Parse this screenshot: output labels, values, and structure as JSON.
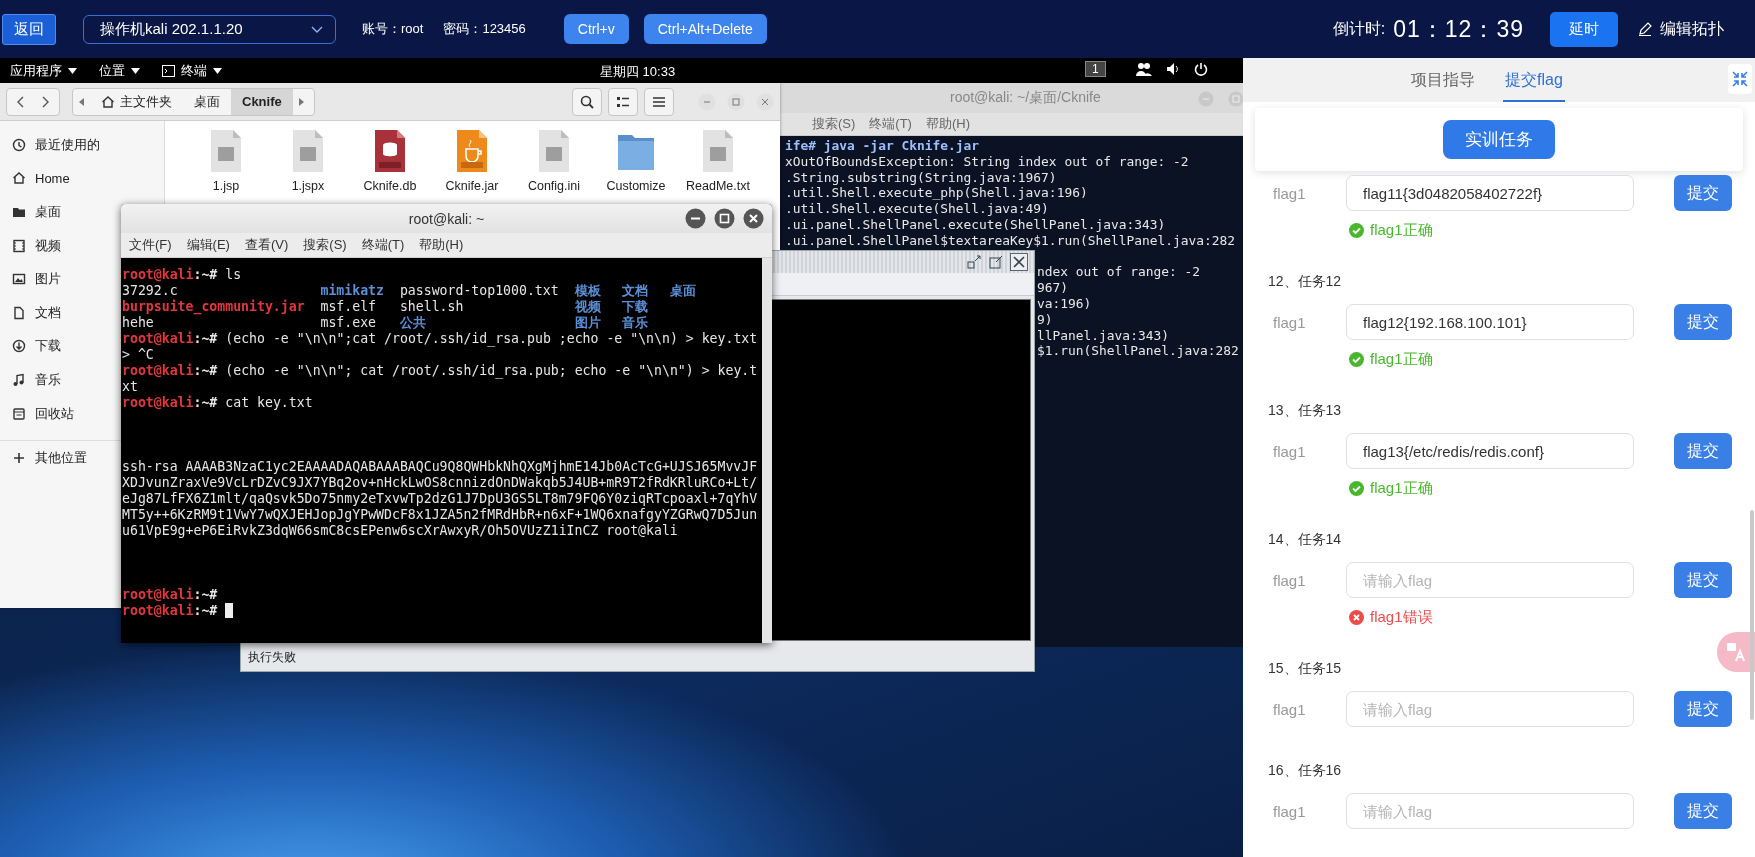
{
  "top_bar": {
    "back_button": "返回",
    "machine_select": "操作机kali 202.1.1.20",
    "account": "账号：root",
    "password": "密码：123456",
    "buttons": [
      "Ctrl+v",
      "Ctrl+Alt+Delete"
    ],
    "countdown_label": "倒计时:",
    "countdown": "01：12：39",
    "extend_button": "延时",
    "edit_topology": "编辑拓扑"
  },
  "desktop": {
    "panel": {
      "menus": [
        "应用程序",
        "位置",
        "终端"
      ],
      "clock": "星期四 10:33",
      "workspace": "1"
    },
    "file_manager": {
      "breadcrumb": [
        {
          "label": "主文件夹",
          "selected": false
        },
        {
          "label": "桌面",
          "selected": false
        },
        {
          "label": "Cknife",
          "selected": true
        }
      ],
      "sidebar": [
        {
          "label": "最近使用的",
          "kind": "recent"
        },
        {
          "label": "Home",
          "kind": "home"
        },
        {
          "label": "桌面",
          "kind": "desktop"
        },
        {
          "label": "视频",
          "kind": "video"
        },
        {
          "label": "图片",
          "kind": "pictures"
        },
        {
          "label": "文档",
          "kind": "documents"
        },
        {
          "label": "下载",
          "kind": "downloads"
        },
        {
          "label": "音乐",
          "kind": "music"
        },
        {
          "label": "回收站",
          "kind": "trash"
        },
        {
          "label": "其他位置",
          "kind": "other"
        }
      ],
      "files": [
        {
          "name": "1.jsp",
          "kind": "text"
        },
        {
          "name": "1.jspx",
          "kind": "text"
        },
        {
          "name": "Cknife.db",
          "kind": "sql"
        },
        {
          "name": "Cknife.jar",
          "kind": "jar"
        },
        {
          "name": "Config.ini",
          "kind": "text"
        },
        {
          "name": "Customize",
          "kind": "folder"
        },
        {
          "name": "ReadMe.txt",
          "kind": "text"
        }
      ]
    },
    "background_terminal": {
      "title": "root@kali: ~/桌面/Cknife",
      "menus": [
        "搜索(S)",
        "终端(T)",
        "帮助(H)"
      ],
      "lines": [
        "ife# java -jar Cknife.jar",
        "xOutOfBoundsException: String index out of range: -2",
        ".String.substring(String.java:1967)",
        ".util.Shell.execute_php(Shell.java:196)",
        ".util.Shell.execute(Shell.java:49)",
        ".ui.panel.ShellPanel.execute(ShellPanel.java:343)",
        ".ui.panel.ShellPanel$textareaKey$1.run(ShellPanel.java:282"
      ],
      "lines_partial": [
        "ndex out of range: -2",
        "967)",
        "va:196)",
        "9)",
        "llPanel.java:343)",
        "$1.run(ShellPanel.java:282"
      ]
    },
    "cknife_window": {
      "status": "执行失败"
    },
    "terminal": {
      "title": "root@kali: ~",
      "menus": [
        "文件(F)",
        "编辑(E)",
        "查看(V)",
        "搜索(S)",
        "终端(T)",
        "帮助(H)"
      ],
      "lines": [
        {
          "kind": "prompt",
          "user": "root@kali",
          "path": ":~#",
          "command": "ls"
        },
        {
          "kind": "ls",
          "cells": [
            {
              "text": "37292.c",
              "kind": "file"
            },
            {
              "text": "mimikatz",
              "kind": "dir"
            },
            {
              "text": "password-top1000.txt",
              "kind": "file"
            },
            {
              "text": "模板",
              "kind": "dir"
            },
            {
              "text": "文档",
              "kind": "dir"
            },
            {
              "text": "桌面",
              "kind": "dir"
            }
          ]
        },
        {
          "kind": "ls",
          "cells": [
            {
              "text": "burpsuite_community.jar",
              "kind": "archive"
            },
            {
              "text": "msf.elf",
              "kind": "file"
            },
            {
              "text": "shell.sh",
              "kind": "file"
            },
            {
              "text": "视频",
              "kind": "dir"
            },
            {
              "text": "下载",
              "kind": "dir"
            }
          ]
        },
        {
          "kind": "ls",
          "cells": [
            {
              "text": "hehe",
              "kind": "file"
            },
            {
              "text": "msf.exe",
              "kind": "file"
            },
            {
              "text": "公共",
              "kind": "dir"
            },
            {
              "text": "图片",
              "kind": "dir"
            },
            {
              "text": "音乐",
              "kind": "dir"
            }
          ]
        },
        {
          "kind": "prompt",
          "user": "root@kali",
          "path": ":~#",
          "command": "(echo -e \"\\n\\n\";cat /root/.ssh/id_rsa.pub ;echo -e \"\\n\\n) > key.txt"
        },
        {
          "kind": "output",
          "text": "> ^C"
        },
        {
          "kind": "prompt",
          "user": "root@kali",
          "path": ":~#",
          "command": "(echo -e \"\\n\\n\"; cat /root/.ssh/id_rsa.pub; echo -e \"\\n\\n\") > key.txt"
        },
        {
          "kind": "prompt",
          "user": "root@kali",
          "path": ":~#",
          "command": "cat key.txt"
        },
        {
          "kind": "blank"
        },
        {
          "kind": "blank"
        },
        {
          "kind": "blank"
        },
        {
          "kind": "output",
          "text": "ssh-rsa AAAAB3NzaC1yc2EAAAADAQABAAABAQCu9Q8QWHbkNhQXgMjhmE14Jb0AcTcG+UJSJ65MvvJFXDJvunZraxVe9VcLrDZvC9JX7YBq2ov+nHckLwOS8cnnizdOnDWakqb5J4UB+mR9T2fRdKRluRCo+Lt/eJg87LfFX6Z1mlt/qaQsvk5Do75nmy2eTxvwTp2dzG1J7DpU3GS5LT8m79FQ6Y0ziqRTcpoaxl+7qYhVMT5y++6KzRM9t1VwY7wQXJEHJopJgYPwWDcF8x1JZA5n2fMRdHbR+n6xF+1WQ6xnafgyYZGRwQ7D5Junu61VpE9g+eP6EiRvkZ3dqW66smC8csEPenw6scXrAwxyR/Oh5OVUzZ1iInCZ root@kali"
        },
        {
          "kind": "blank"
        },
        {
          "kind": "blank"
        },
        {
          "kind": "blank"
        },
        {
          "kind": "prompt",
          "user": "root@kali",
          "path": ":~#"
        },
        {
          "kind": "prompt",
          "user": "root@kali",
          "path": ":~#",
          "cursor": true
        }
      ]
    }
  },
  "flag_panel": {
    "tabs": [
      {
        "label": "项目指导",
        "selected": false
      },
      {
        "label": "提交flag",
        "selected": true
      }
    ],
    "task_button": "实训任务",
    "tasks": [
      {
        "kind": "correct",
        "label": "flag1",
        "value": "flag11{3d0482058402722f}",
        "submit": "提交",
        "message": "flag1正确"
      },
      {
        "kind": "correct",
        "title": "12、任务12",
        "label": "flag1",
        "value": "flag12{192.168.100.101}",
        "submit": "提交",
        "message": "flag1正确"
      },
      {
        "kind": "correct",
        "title": "13、任务13",
        "label": "flag1",
        "value": "flag13{/etc/redis/redis.conf}",
        "submit": "提交",
        "message": "flag1正确"
      },
      {
        "kind": "wrong",
        "title": "14、任务14",
        "label": "flag1",
        "placeholder": "请输入flag",
        "submit": "提交",
        "message": "flag1错误"
      },
      {
        "kind": "empty",
        "title": "15、任务15",
        "label": "flag1",
        "placeholder": "请输入flag",
        "submit": "提交"
      },
      {
        "kind": "empty",
        "title": "16、任务16",
        "label": "flag1",
        "placeholder": "请输入flag",
        "submit": "提交"
      }
    ]
  }
}
